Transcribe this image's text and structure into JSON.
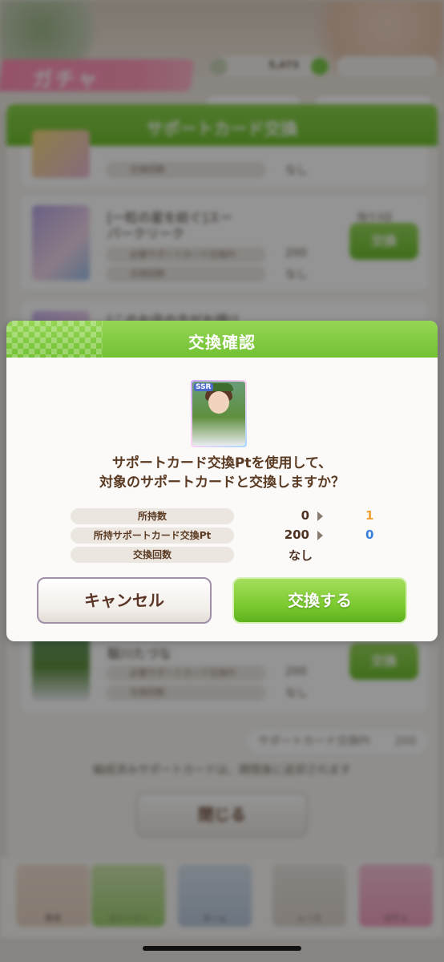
{
  "background": {
    "header_title": "ガチャ",
    "coin_count": "5,473",
    "panel_title": "サポートカード交換",
    "rows": [
      {
        "name": "",
        "label": "交換回数",
        "value": "なし"
      },
      {
        "name": "[一粒の星を紡ぐ]スーパークリーク",
        "remaining": "残り3日",
        "label_pt": "必要サポートカード交換Pt",
        "pt_value": "200",
        "label_count": "交換回数",
        "count_value": "なし",
        "button": "交換"
      },
      {
        "name": "[このお店の方がお得!]",
        "remaining": "",
        "label_pt": "",
        "pt_value": "",
        "label_count": "",
        "count_value": "",
        "button": ""
      },
      {
        "name": "駿川たづな",
        "remaining": "",
        "label_pt": "必要サポートカード交換Pt",
        "pt_value": "200",
        "label_count": "交換回数",
        "count_value": "なし",
        "button": "交換"
      }
    ],
    "owned_pt_label": "サポートカード交換Pt",
    "owned_pt_value": "200",
    "note": "編成済みサポートカードは、期限後に返却されます",
    "close_label": "閉じる",
    "nav": [
      {
        "label": "育成"
      },
      {
        "label": "ストーリー"
      },
      {
        "label": "ホーム"
      },
      {
        "label": "レース"
      },
      {
        "label": "ガチャ"
      }
    ]
  },
  "dialog": {
    "title": "交換確認",
    "card_rarity": "SSR",
    "message_line1": "サポートカード交換Ptを使用して、",
    "message_line2": "対象のサポートカードと交換しますか？",
    "info": [
      {
        "label": "所持数",
        "before": "0",
        "after": "1",
        "after_color": "#f0a030"
      },
      {
        "label": "所持サポートカード交換Pt",
        "before": "200",
        "after": "0",
        "after_color": "#3a7fdc"
      },
      {
        "label": "交換回数",
        "before": "なし",
        "after": ""
      }
    ],
    "cancel_label": "キャンセル",
    "confirm_label": "交換する"
  }
}
